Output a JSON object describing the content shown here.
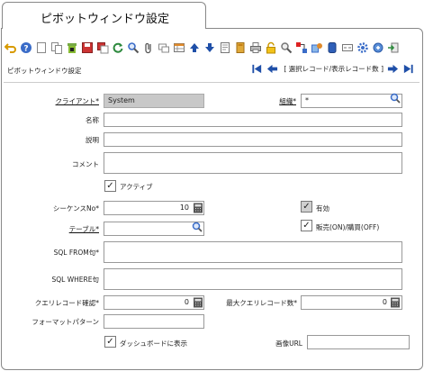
{
  "window": {
    "tab_title": "ピボットウィンドウ設定",
    "subtitle": "ピボットウィンドウ設定"
  },
  "toolbar": {
    "icons": [
      "undo-icon",
      "help-icon",
      "new-record-icon",
      "copy-record-icon",
      "delete-icon",
      "save-icon",
      "save-copy-icon",
      "refresh-icon",
      "find-icon",
      "attachment-icon",
      "chat-icon",
      "grid-toggle-icon",
      "previous-record-icon",
      "next-record-icon",
      "report-icon",
      "archive-icon",
      "print-icon",
      "lock-icon",
      "zoom-icon",
      "workflow-icon",
      "product-info-icon",
      "request-icon",
      "form-icon",
      "settings-icon",
      "process-icon",
      "exit-icon"
    ]
  },
  "nav": {
    "label": "[ 選択レコード/表示レコード数 ]"
  },
  "form": {
    "client": {
      "label": "クライアント*",
      "value": "System"
    },
    "org": {
      "label": "組織*",
      "value": "*"
    },
    "name": {
      "label": "名称"
    },
    "description": {
      "label": "説明"
    },
    "comment": {
      "label": "コメント"
    },
    "active": {
      "label": "アクティブ",
      "checked": true
    },
    "seq": {
      "label": "シーケンスNo*",
      "value": "10"
    },
    "valid": {
      "label": "有効",
      "checked": true
    },
    "table": {
      "label": "テーブル*"
    },
    "sales": {
      "label": "販売(ON)/購買(OFF)",
      "checked": true
    },
    "sql_from": {
      "label": "SQL FROM句*"
    },
    "sql_where": {
      "label": "SQL WHERE句"
    },
    "query_confirm": {
      "label": "クエリレコード確認*",
      "value": "0"
    },
    "max_query": {
      "label": "最大クエリレコード数*",
      "value": "0"
    },
    "format": {
      "label": "フォーマットパターン"
    },
    "dashboard": {
      "label": "ダッシュボードに表示",
      "checked": true
    },
    "image_url": {
      "label": "画像URL"
    }
  },
  "colors": {
    "nav_blue": "#1f4fa8",
    "readonly_gray": "#c8c8c8"
  }
}
